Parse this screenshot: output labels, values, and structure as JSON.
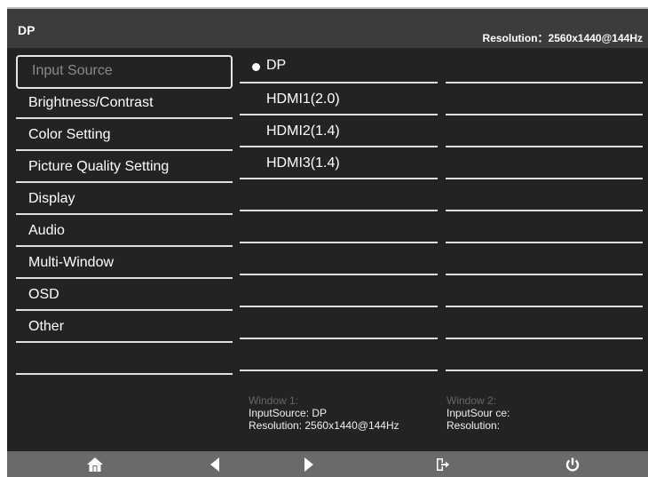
{
  "header": {
    "title": "DP",
    "resolution": "Resolution：2560x1440@144Hz"
  },
  "menu": {
    "items": [
      {
        "label": "Input Source"
      },
      {
        "label": "Brightness/Contrast"
      },
      {
        "label": "Color Setting"
      },
      {
        "label": "Picture Quality Setting"
      },
      {
        "label": "Display"
      },
      {
        "label": "Audio"
      },
      {
        "label": "Multi-Window"
      },
      {
        "label": "OSD"
      },
      {
        "label": "Other"
      },
      {
        "label": ""
      }
    ]
  },
  "submenu": {
    "items": [
      {
        "label": "DP"
      },
      {
        "label": "HDMI1(2.0)"
      },
      {
        "label": "HDMI2(1.4)"
      },
      {
        "label": "HDMI3(1.4)"
      },
      {
        "label": ""
      },
      {
        "label": ""
      },
      {
        "label": ""
      },
      {
        "label": ""
      },
      {
        "label": ""
      },
      {
        "label": ""
      }
    ]
  },
  "window1": {
    "title": "Window 1:",
    "input": "InputSource: DP",
    "resolution": "Resolution: 2560x1440@144Hz"
  },
  "window2": {
    "title": "Window 2:",
    "input": "InputSour ce:",
    "resolution": "Resolution:"
  },
  "footer": {
    "icons": [
      "home-icon",
      "left-arrow-icon",
      "right-arrow-icon",
      "exit-icon",
      "power-icon"
    ]
  },
  "colors": {
    "background": "#232323",
    "header": "#3c3c3c",
    "footer": "#6a6a6a",
    "text": "#ffffff",
    "selected_text": "#8a8a8a"
  }
}
